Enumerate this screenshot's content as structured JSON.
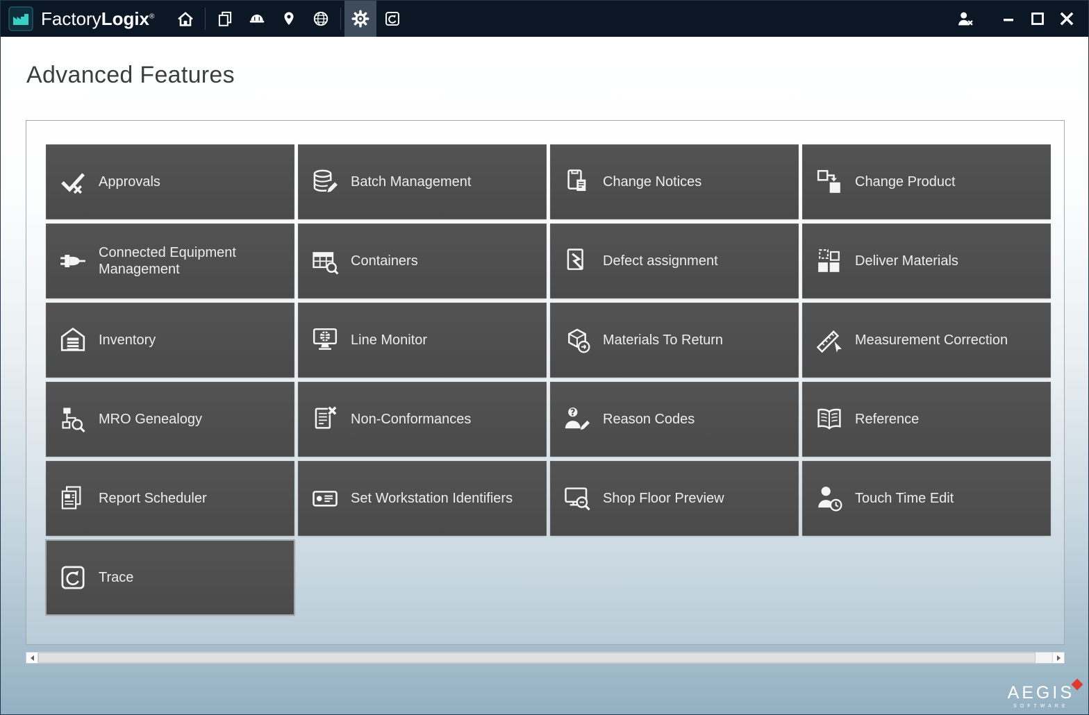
{
  "window": {
    "app_name": {
      "primary": "Factory",
      "secondary": "Logix",
      "mark": "®"
    },
    "toolbar_icons": [
      "home",
      "documents",
      "hard-hat",
      "location-pin",
      "globe",
      "settings-gear",
      "trace"
    ],
    "active_tool": "settings-gear",
    "controls": [
      "user-sign-out",
      "minimize",
      "maximize",
      "close"
    ]
  },
  "page": {
    "title": "Advanced Features"
  },
  "tiles": [
    {
      "label": "Approvals",
      "icon": "approvals-check-icon"
    },
    {
      "label": "Batch Management",
      "icon": "database-edit-icon"
    },
    {
      "label": "Change Notices",
      "icon": "document-change-icon"
    },
    {
      "label": "Change Product",
      "icon": "product-swap-icon"
    },
    {
      "label": "Connected Equipment Management",
      "icon": "plug-icon"
    },
    {
      "label": "Containers",
      "icon": "table-search-icon"
    },
    {
      "label": "Defect assignment",
      "icon": "defect-document-icon"
    },
    {
      "label": "Deliver Materials",
      "icon": "boxes-icon"
    },
    {
      "label": "Inventory",
      "icon": "warehouse-icon"
    },
    {
      "label": "Line Monitor",
      "icon": "monitor-globe-icon"
    },
    {
      "label": "Materials To Return",
      "icon": "box-return-icon"
    },
    {
      "label": "Measurement Correction",
      "icon": "ruler-cursor-icon"
    },
    {
      "label": "MRO Genealogy",
      "icon": "hierarchy-search-icon"
    },
    {
      "label": "Non-Conformances",
      "icon": "document-x-icon"
    },
    {
      "label": "Reason Codes",
      "icon": "person-question-icon"
    },
    {
      "label": "Reference",
      "icon": "open-book-icon"
    },
    {
      "label": "Report Scheduler",
      "icon": "report-pages-icon"
    },
    {
      "label": "Set Workstation Identifiers",
      "icon": "id-badge-icon"
    },
    {
      "label": "Shop Floor Preview",
      "icon": "monitor-search-icon"
    },
    {
      "label": "Touch Time Edit",
      "icon": "person-clock-icon"
    },
    {
      "label": "Trace",
      "icon": "trace-rotate-icon"
    }
  ],
  "scrollbar": {
    "orientation": "horizontal"
  },
  "branding": {
    "name": "AEGIS",
    "tagline": "SOFTWARE"
  },
  "colors": {
    "titlebar_bg": "#0c1725",
    "tile_bg": "#4c4c4c",
    "background_bottom": "#93b0c2",
    "accent_teal": "#38cfc4",
    "accent_red": "#e03a2f"
  }
}
